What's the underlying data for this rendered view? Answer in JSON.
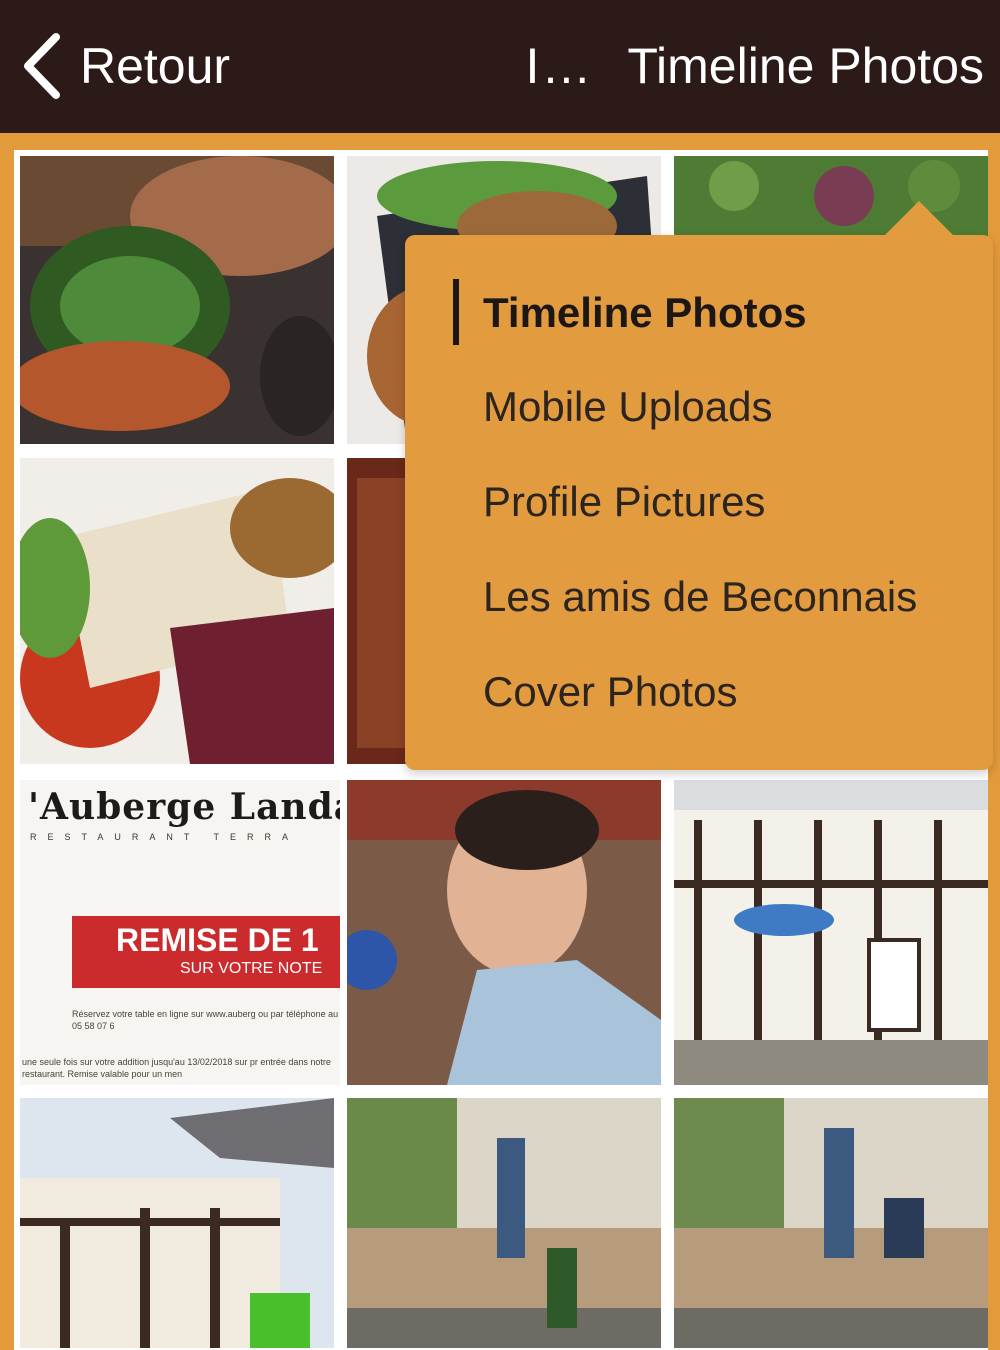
{
  "header": {
    "back_label": "Retour",
    "title_truncated": "I…",
    "title": "Timeline Photos"
  },
  "album_menu": {
    "items": [
      {
        "label": "Timeline Photos",
        "active": true
      },
      {
        "label": "Mobile Uploads",
        "active": false
      },
      {
        "label": "Profile Pictures",
        "active": false
      },
      {
        "label": "Les amis de Beconnais",
        "active": false
      },
      {
        "label": "Cover Photos",
        "active": false
      }
    ]
  },
  "promo_photo": {
    "brand": "'Auberge Landa",
    "subtitle": "RESTAURANT TERRA",
    "banner_main": "REMISE DE 1",
    "banner_sub": "SUR VOTRE NOTE",
    "fine_print": "Réservez votre table en ligne sur www.auberg ou par téléphone au 05 58 07 6",
    "fine_print_2": "une seule fois sur votre addition jusqu'au 13/02/2018 sur pr entrée dans notre restaurant. Remise valable pour un men"
  },
  "colors": {
    "header_bg": "#2B1A18",
    "accent_orange": "#E39A3A",
    "menu_bg": "#E29B3F",
    "menu_text": "#2C241E"
  },
  "icons": {
    "back": "chevron-left-icon"
  }
}
